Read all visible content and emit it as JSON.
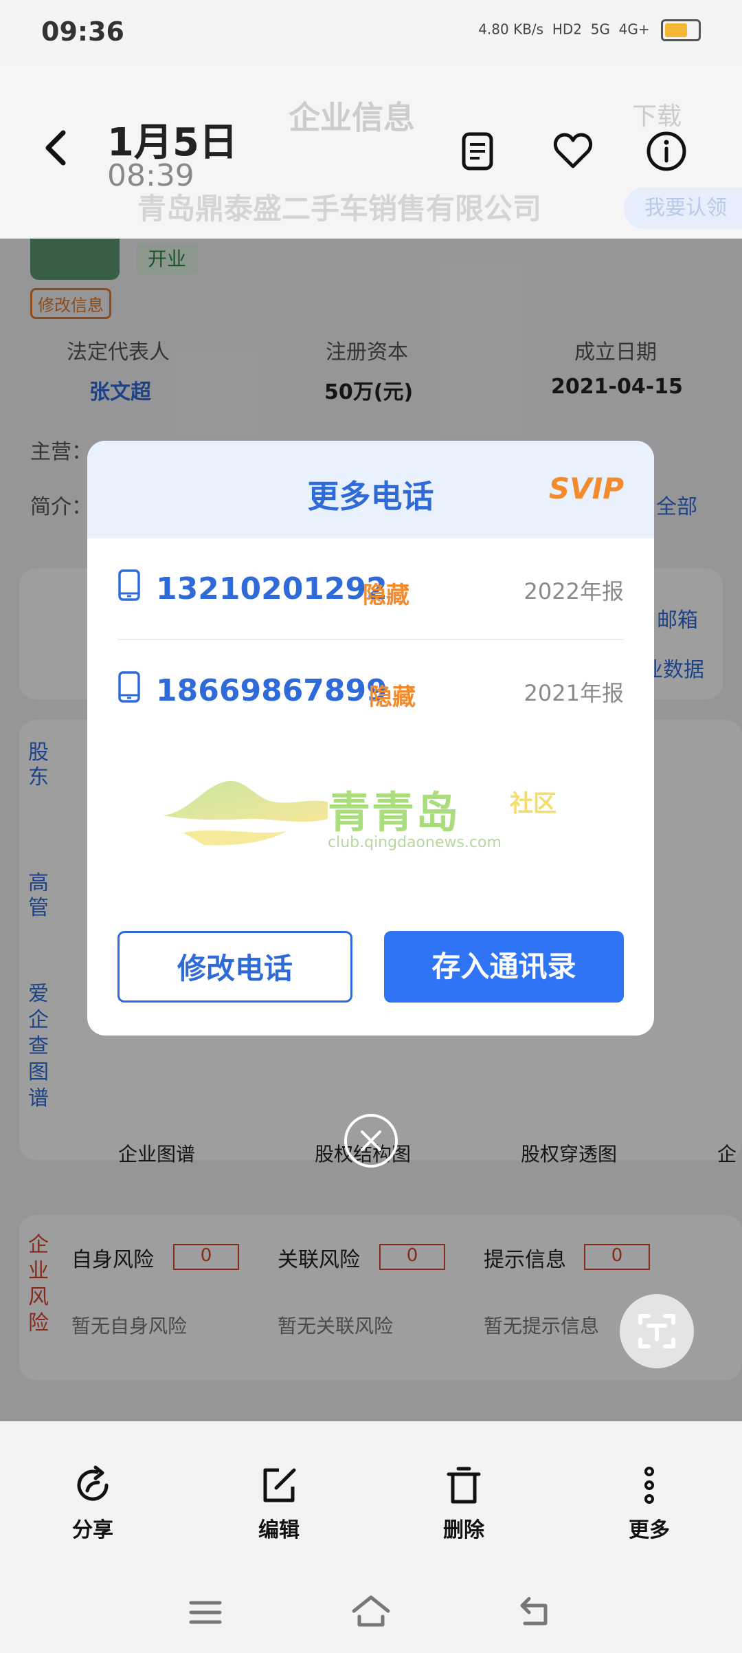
{
  "status_bar": {
    "time": "09:36",
    "net_speed": "4.80 KB/s",
    "signal_labels": [
      "HD2",
      "5G",
      "4G+"
    ]
  },
  "viewer": {
    "date": "1月5日",
    "time": "08:39"
  },
  "background_page": {
    "header_title": "企业信息",
    "download_label": "下载",
    "company_name": "青岛鼎泰盛二手车销售有限公司",
    "claim_label": "我要认领",
    "status_tag": "开业",
    "edit_info": "修改信息",
    "info": [
      {
        "label": "法定代表人",
        "value": "张文超"
      },
      {
        "label": "注册资本",
        "value": "50万(元)"
      },
      {
        "label": "成立日期",
        "value": "2021-04-15"
      }
    ],
    "main_business_label": "主营：",
    "intro_label": "简介：",
    "all_label": "全部",
    "email_label": "邮箱",
    "enterprise_data_label": "业数据",
    "side_tabs": [
      "股东",
      "高管",
      "爱企查图谱"
    ],
    "graph_labels": [
      "企业图谱",
      "股权结构图",
      "股权穿透图",
      "企"
    ],
    "risk_tab": "企业风险",
    "risks": [
      {
        "title": "自身风险",
        "count": "0",
        "desc": "暂无自身风险"
      },
      {
        "title": "关联风险",
        "count": "0",
        "desc": "暂无关联风险"
      },
      {
        "title": "提示信息",
        "count": "0",
        "desc": "暂无提示信息"
      }
    ]
  },
  "modal": {
    "title": "更多电话",
    "badge": "SVIP",
    "phones": [
      {
        "number": "13210201292",
        "hidden_label": "隐藏",
        "year": "2022年报"
      },
      {
        "number": "18669867899",
        "hidden_label": "隐藏",
        "year": "2021年报"
      }
    ],
    "watermark_title": "青青岛",
    "watermark_tag": "社区",
    "watermark_url": "club.qingdaonews.com",
    "edit_phone_button": "修改电话",
    "save_contacts_button": "存入通讯录"
  },
  "action_bar": [
    {
      "label": "分享",
      "icon": "share-icon"
    },
    {
      "label": "编辑",
      "icon": "edit-icon"
    },
    {
      "label": "删除",
      "icon": "delete-icon"
    },
    {
      "label": "更多",
      "icon": "more-icon"
    }
  ],
  "colors": {
    "accent": "#2f6bd8",
    "primary_button": "#2f74f4",
    "orange": "#f28a2e",
    "modal_head": "#e9f1fd"
  }
}
